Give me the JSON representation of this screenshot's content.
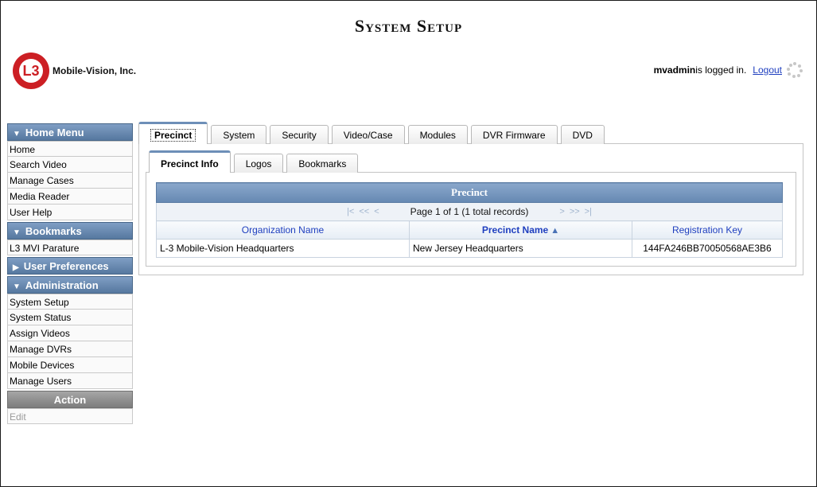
{
  "header": {
    "title": "System Setup",
    "logo_mark": "L3",
    "company": "Mobile-Vision, Inc.",
    "user": "mvadmin",
    "logged_in_text": " is logged in.",
    "logout_label": "Logout"
  },
  "sidebar": {
    "home_menu": {
      "label": "Home Menu",
      "items": [
        "Home",
        "Search Video",
        "Manage Cases",
        "Media Reader",
        "User Help"
      ]
    },
    "bookmarks": {
      "label": "Bookmarks",
      "items": [
        "L3 MVI Parature"
      ]
    },
    "user_preferences": {
      "label": "User Preferences"
    },
    "administration": {
      "label": "Administration",
      "items": [
        "System Setup",
        "System Status",
        "Assign Videos",
        "Manage DVRs",
        "Mobile Devices",
        "Manage Users"
      ]
    },
    "action": {
      "label": "Action",
      "items": [
        "Edit"
      ]
    }
  },
  "tabs": [
    "Precinct",
    "System",
    "Security",
    "Video/Case",
    "Modules",
    "DVR Firmware",
    "DVD"
  ],
  "subtabs": [
    "Precinct Info",
    "Logos",
    "Bookmarks"
  ],
  "grid": {
    "caption": "Precinct",
    "pager_text": "Page 1 of 1 (1 total records)",
    "pager_first": "|<",
    "pager_prev_page": "<<",
    "pager_prev": "<",
    "pager_next": ">",
    "pager_next_page": ">>",
    "pager_last": ">|",
    "columns": [
      "Organization Name",
      "Precinct Name",
      "Registration Key"
    ],
    "sort_icon": "▲",
    "rows": [
      [
        "L-3 Mobile-Vision Headquarters",
        "New Jersey Headquarters",
        "144FA246BB70050568AE3B6"
      ]
    ]
  },
  "icons": {
    "spinner": "spinner-icon",
    "sort": "sort-ascending-icon"
  },
  "colors": {
    "accent": "#6588b2",
    "link": "#1f3fbf",
    "logo_red": "#cc1f24"
  }
}
